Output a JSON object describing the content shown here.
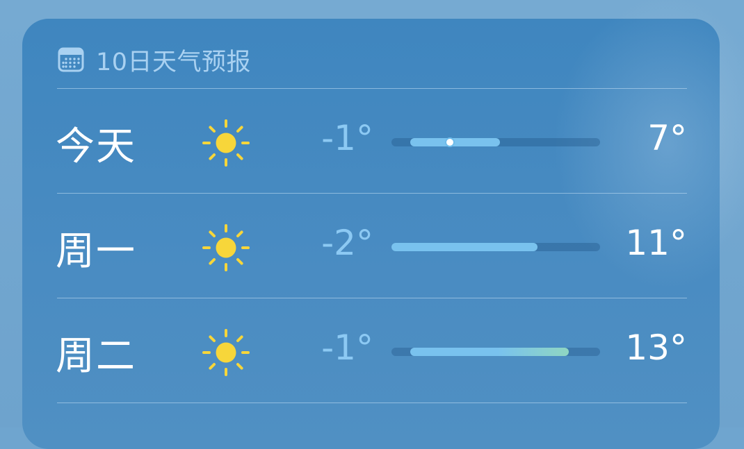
{
  "forecast": {
    "title": "10日天气预报",
    "header_icon": "calendar-icon",
    "colors": {
      "card": "#4288c0",
      "low_text": "#8cc9f3",
      "bar_cool": "#79c2ee",
      "bar_warm": "#8fd6c2",
      "sun": "#f7d63a"
    },
    "days": [
      {
        "label": "今天",
        "icon": "sun-icon",
        "low": "-1°",
        "high": "7°",
        "range_start": 0.09,
        "range_end": 0.52,
        "current_marker": 0.28,
        "gradient": false
      },
      {
        "label": "周一",
        "icon": "sun-icon",
        "low": "-2°",
        "high": "11°",
        "range_start": 0.0,
        "range_end": 0.7,
        "gradient": false
      },
      {
        "label": "周二",
        "icon": "sun-icon",
        "low": "-1°",
        "high": "13°",
        "range_start": 0.09,
        "range_end": 0.85,
        "gradient": true
      }
    ]
  }
}
